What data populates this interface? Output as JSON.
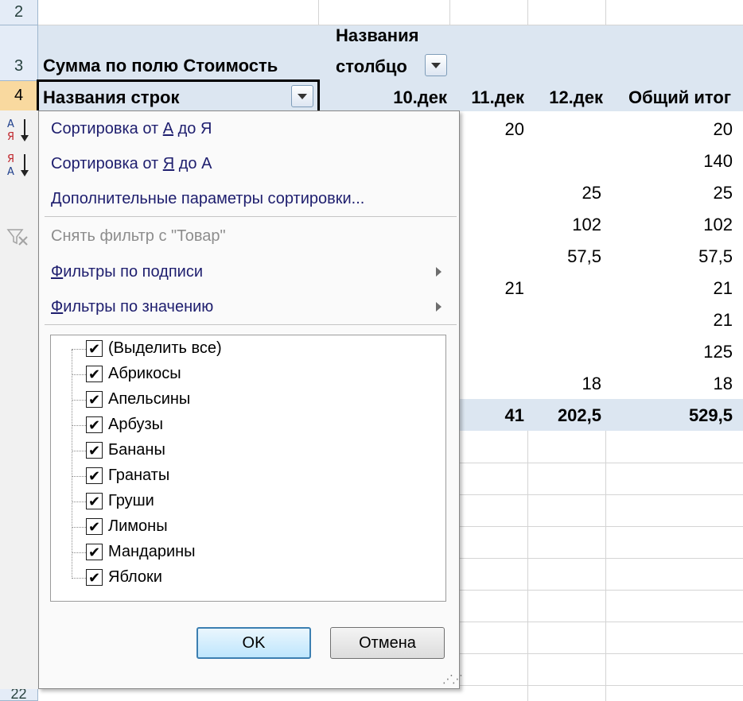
{
  "rows": {
    "numbers": [
      "2",
      "3",
      "4",
      "22"
    ]
  },
  "pivot": {
    "values_label": "Сумма по полю Стоимость",
    "column_labels_line1": "Названия",
    "column_labels_line2": "столбцо",
    "row_labels": "Названия строк",
    "columns": [
      "10.дек",
      "11.дек",
      "12.дек",
      "Общий итог"
    ],
    "data_rows": [
      {
        "c11": "20",
        "c12": "",
        "total": "20"
      },
      {
        "c11": "",
        "c12": "",
        "total": "140"
      },
      {
        "c11": "",
        "c12": "25",
        "total": "25"
      },
      {
        "c11": "",
        "c12": "102",
        "total": "102"
      },
      {
        "c11": "",
        "c12": "57,5",
        "total": "57,5"
      },
      {
        "c11": "21",
        "c12": "",
        "total": "21"
      },
      {
        "c11": "",
        "c12": "",
        "total": "21"
      },
      {
        "c11": "",
        "c12": "",
        "total": "125"
      },
      {
        "c11": "",
        "c12": "18",
        "total": "18"
      }
    ],
    "grand_total": {
      "c11": "41",
      "c12": "202,5",
      "total": "529,5"
    }
  },
  "menu": {
    "sort_asc": {
      "pre": "Сортировка от ",
      "key": "А",
      "mid": " до Я"
    },
    "sort_desc": {
      "pre": "Сортировка от ",
      "key": "Я",
      "mid": " до А"
    },
    "more_sort": {
      "key": "Д",
      "rest": "ополнительные параметры сортировки..."
    },
    "clear_filter": "Снять фильтр с \"Товар\"",
    "label_filters": {
      "key": "Ф",
      "rest": "ильтры по подписи"
    },
    "value_filters": {
      "key": "Ф",
      "rest": "ильтры по значению"
    }
  },
  "checklist": [
    {
      "label": "(Выделить все)",
      "checked": true
    },
    {
      "label": "Абрикосы",
      "checked": true
    },
    {
      "label": "Апельсины",
      "checked": true
    },
    {
      "label": "Арбузы",
      "checked": true
    },
    {
      "label": "Бананы",
      "checked": true
    },
    {
      "label": "Гранаты",
      "checked": true
    },
    {
      "label": "Груши",
      "checked": true
    },
    {
      "label": "Лимоны",
      "checked": true
    },
    {
      "label": "Мандарины",
      "checked": true
    },
    {
      "label": "Яблоки",
      "checked": true
    }
  ],
  "buttons": {
    "ok": "OK",
    "cancel": "Отмена"
  },
  "icons": {
    "sort_asc": "sort-ascending-icon",
    "sort_desc": "sort-descending-icon",
    "clear_filter": "clear-filter-icon",
    "check": "✔"
  },
  "colors": {
    "pivot_band": "#dce6f1",
    "row_header": "#e4ecf7",
    "row_header_selected": "#f9d99f",
    "menu_text": "#1e1e6e"
  }
}
